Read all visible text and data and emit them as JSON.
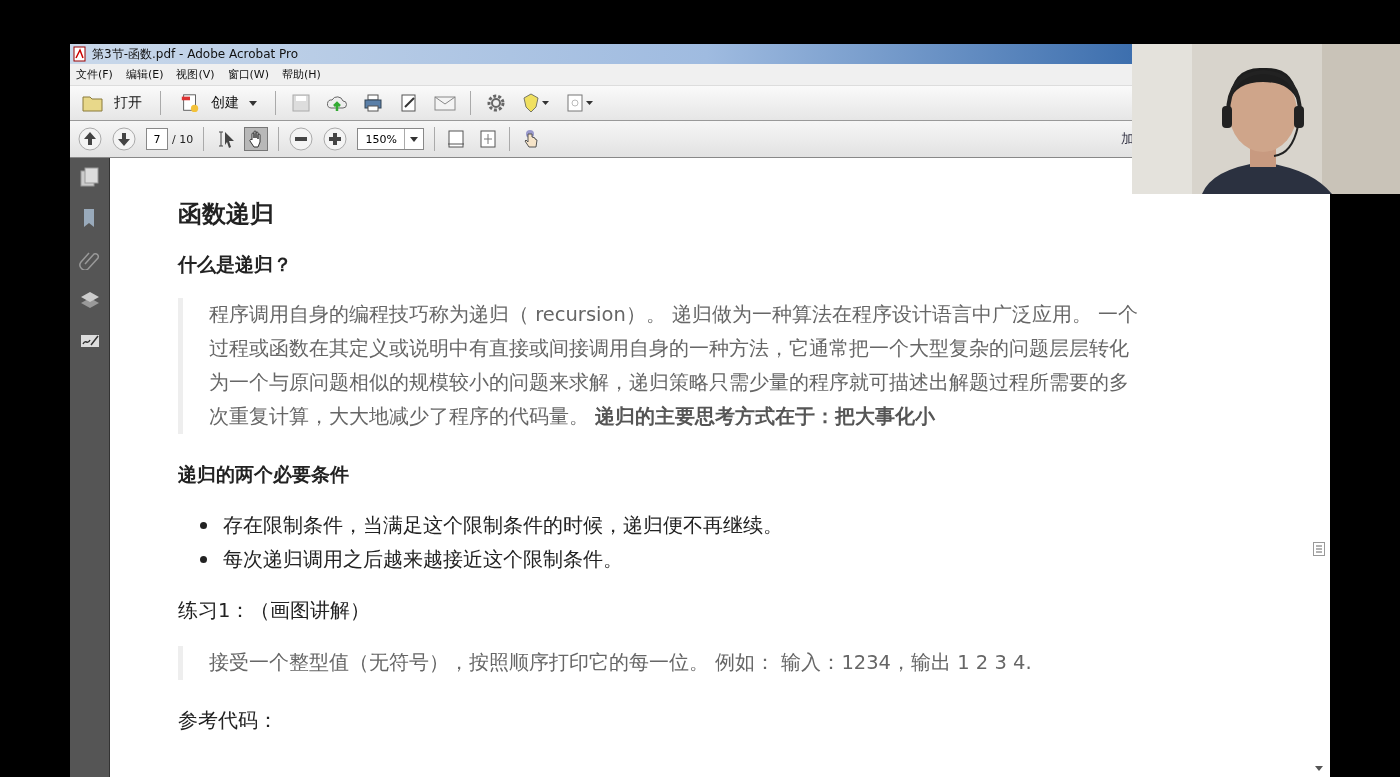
{
  "window": {
    "title": "第3节-函数.pdf - Adobe Acrobat Pro"
  },
  "menu": [
    "文件(F)",
    "编辑(E)",
    "视图(V)",
    "窗口(W)",
    "帮助(H)"
  ],
  "toolbar": {
    "open": "打开",
    "create": "创建"
  },
  "navigation": {
    "page": "7",
    "total": "/ 10",
    "zoom": "150%",
    "cut_label": "加",
    "tools": [
      {
        "kind": "select",
        "selected": false
      },
      {
        "kind": "hand",
        "selected": true
      }
    ]
  },
  "document": [
    {
      "kind": "title",
      "text": "函数递归"
    },
    {
      "kind": "heading",
      "text": "什么是递归？"
    },
    {
      "kind": "quote",
      "text": "程序调用自身的编程技巧称为递归（ recursion）。 递归做为一种算法在程序设计语言中广泛应用。 一个过程或函数在其定义或说明中有直接或间接调用自身的一种方法，它通常把一个大型复杂的问题层层转化为一个与原问题相似的规模较小的问题来求解，递归策略只需少量的程序就可描述出解题过程所需要的多次重复计算，大大地减少了程序的代码量。 **递归的主要思考方式在于：把大事化小**"
    },
    {
      "kind": "heading",
      "text": "递归的两个必要条件"
    },
    {
      "kind": "bullets",
      "items": [
        "存在限制条件，当满足这个限制条件的时候，递归便不再继续。",
        "每次递归调用之后越来越接近这个限制条件。"
      ]
    },
    {
      "kind": "para",
      "text": "练习1：（画图讲解）"
    },
    {
      "kind": "quote",
      "text": "接受一个整型值（无符号），按照顺序打印它的每一位。 例如： 输入：1234，输出 1 2 3 4."
    },
    {
      "kind": "para",
      "text": "参考代码："
    }
  ]
}
